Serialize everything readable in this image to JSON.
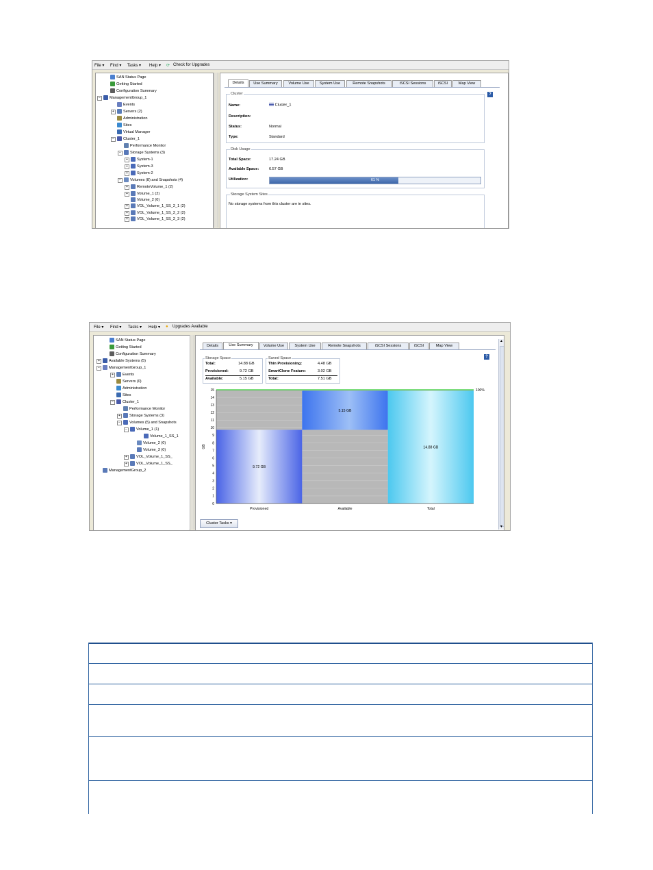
{
  "screen1": {
    "menu": [
      "File ▾",
      "Find ▾",
      "Tasks ▾",
      "Help ▾",
      "Check for Upgrades"
    ],
    "tree": [
      {
        "label": "SAN Status Page",
        "icon": "home-icon"
      },
      {
        "label": "Getting Started",
        "icon": "arrow-icon"
      },
      {
        "label": "Configuration Summary",
        "icon": "sigma-icon"
      },
      {
        "label": "ManagementGroup_1",
        "icon": "group-icon"
      },
      {
        "label": "Events",
        "icon": "events-icon"
      },
      {
        "label": "Servers (2)",
        "icon": "servers-icon"
      },
      {
        "label": "Administration",
        "icon": "admin-icon"
      },
      {
        "label": "Sites",
        "icon": "sites-icon"
      },
      {
        "label": "Virtual Manager",
        "icon": "virtual-manager-icon"
      },
      {
        "label": "Cluster_1",
        "icon": "cluster-icon"
      },
      {
        "label": "Performance Monitor",
        "icon": "monitor-icon"
      },
      {
        "label": "Storage Systems (3)",
        "icon": "storage-icon"
      },
      {
        "label": "System-1",
        "icon": "system-icon"
      },
      {
        "label": "System-3",
        "icon": "system-icon"
      },
      {
        "label": "System-2",
        "icon": "system-icon"
      },
      {
        "label": "Volumes (8) and Snapshots (4)",
        "icon": "volumes-icon"
      },
      {
        "label": "RemoteVolume_1 (2)",
        "icon": "volume-icon"
      },
      {
        "label": "Volume_1 (2)",
        "icon": "volume-icon"
      },
      {
        "label": "Volume_2 (0)",
        "icon": "volume-icon"
      },
      {
        "label": "VOL_Volume_1_SS_2_1 (2)",
        "icon": "volume-icon"
      },
      {
        "label": "VOL_Volume_1_SS_2_2 (2)",
        "icon": "volume-icon"
      },
      {
        "label": "VOL_Volume_1_SS_2_3 (2)",
        "icon": "volume-icon"
      }
    ],
    "tabs": [
      "Details",
      "Use Summary",
      "Volume Use",
      "System Use",
      "Remote Snapshots",
      "iSCSI Sessions",
      "iSCSI",
      "Map View"
    ],
    "help": "?",
    "cluster_panel": {
      "title": "Cluster",
      "name_label": "Name:",
      "name_value": "Cluster_1",
      "desc_label": "Description:",
      "status_label": "Status:",
      "status_value": "Normal",
      "type_label": "Type:",
      "type_value": "Standard"
    },
    "disk_panel": {
      "title": "Disk Usage",
      "total_label": "Total Space:",
      "total_value": "17.24 GB",
      "avail_label": "Available Space:",
      "avail_value": "6.57 GB",
      "util_label": "Utilization:",
      "util_value": "61 %",
      "util_fraction": 0.61
    },
    "sites_panel": {
      "title": "Storage System Sites",
      "text": "No storage systems from this cluster are in sites."
    }
  },
  "screen2": {
    "menu": [
      "File ▾",
      "Find ▾",
      "Tasks ▾",
      "Help ▾",
      "Upgrades Available"
    ],
    "tree": [
      {
        "label": "SAN Status Page"
      },
      {
        "label": "Getting Started"
      },
      {
        "label": "Configuration Summary"
      },
      {
        "label": "Available Systems (5)"
      },
      {
        "label": "ManagementGroup_1"
      },
      {
        "label": "Events"
      },
      {
        "label": "Servers (0)"
      },
      {
        "label": "Administration"
      },
      {
        "label": "Sites"
      },
      {
        "label": "Cluster_1"
      },
      {
        "label": "Performance Monitor"
      },
      {
        "label": "Storage Systems (3)"
      },
      {
        "label": "Volumes (5) and Snapshots"
      },
      {
        "label": "Volume_1 (1)"
      },
      {
        "label": "Volume_1_SS_1"
      },
      {
        "label": "Volume_2 (0)"
      },
      {
        "label": "Volume_3 (0)"
      },
      {
        "label": "VOL_Volume_1_SS_"
      },
      {
        "label": "VOL_Volume_1_SS_"
      },
      {
        "label": "ManagementGroup_2"
      }
    ],
    "tabs": [
      "Details",
      "Use Summary",
      "Volume Use",
      "System Use",
      "Remote Snapshots",
      "iSCSI Sessions",
      "iSCSI",
      "Map View"
    ],
    "help": "?",
    "storage_space": {
      "title": "Storage Space",
      "total_label": "Total:",
      "total_value": "14.88 GB",
      "prov_label": "Provisioned:",
      "prov_value": "9.72 GB",
      "avail_label": "Available:",
      "avail_value": "5.15 GB"
    },
    "saved_space": {
      "title": "Saved Space",
      "thin_label": "Thin Provisioning:",
      "thin_value": "4.48 GB",
      "clone_label": "SmartClone Feature:",
      "clone_value": "3.02 GB",
      "total_label": "Total:",
      "total_value": "7.51 GB"
    },
    "cluster_tasks": "Cluster Tasks ▾"
  },
  "chart_data": {
    "type": "bar",
    "categories": [
      "Provisioned",
      "Available",
      "Total"
    ],
    "ylabel": "GB",
    "ylim": [
      0,
      15
    ],
    "yticks": [
      "0",
      "1",
      "2",
      "3",
      "4",
      "5",
      "6",
      "7",
      "8",
      "9",
      "10",
      "11",
      "12",
      "13",
      "14",
      "15"
    ],
    "bars": [
      {
        "category": "Provisioned",
        "base": 0,
        "top": 9.72,
        "label": "9.72 GB"
      },
      {
        "category": "Available",
        "base": 9.72,
        "top": 14.87,
        "label": "5.15 GB"
      },
      {
        "category": "Total",
        "base": 0,
        "top": 14.88,
        "label": "14.88 GB"
      }
    ],
    "reference_line": {
      "value": 15,
      "label": "100%",
      "color": "#33cc33"
    },
    "colors": {
      "Provisioned": "#5577ee",
      "Available": "#4477ee",
      "Total": "#55ccee",
      "background": "#b8b8b8"
    }
  },
  "table": {
    "rows": 6
  }
}
